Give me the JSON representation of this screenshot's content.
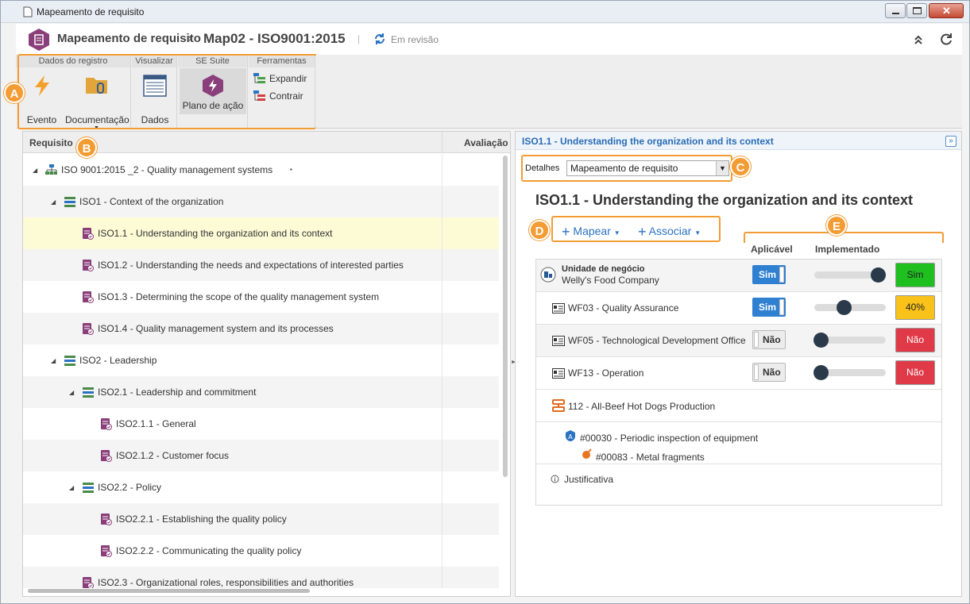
{
  "window": {
    "title": "Mapeamento de requisito"
  },
  "header": {
    "app": "Mapeamento de requisito",
    "separator": "›",
    "record": "Map02 - ISO9001:2015",
    "bar": "|",
    "status": "Em revisão"
  },
  "ribbon": {
    "groups": [
      {
        "title": "Dados do registro",
        "buttons": [
          "Evento",
          "Documentação"
        ]
      },
      {
        "title": "Visualizar",
        "buttons": [
          "Dados"
        ]
      },
      {
        "title": "SE Suite",
        "buttons": [
          "Plano de ação"
        ]
      },
      {
        "title": "Ferramentas",
        "buttons": [
          "Expandir",
          "Contrair"
        ]
      }
    ]
  },
  "markers": {
    "a": "A",
    "b": "B",
    "c": "C",
    "d": "D",
    "e": "E"
  },
  "left": {
    "col_requisito": "Requisito",
    "col_avaliacao": "Avaliação",
    "rows": [
      "ISO 9001:2015 _2 - Quality management systems",
      "ISO1 - Context of the organization",
      "ISO1.1 - Understanding the organization and its context",
      "ISO1.2 - Understanding the needs and expectations of interested parties",
      "ISO1.3 - Determining the scope of the quality management system",
      "ISO1.4 - Quality management system and its processes",
      "ISO2 - Leadership",
      "ISO2.1 - Leadership and commitment",
      "ISO2.1.1 - General",
      "ISO2.1.2 - Customer focus",
      "ISO2.2 - Policy",
      "ISO2.2.1 - Establishing the quality policy",
      "ISO2.2.2 - Communicating the quality policy",
      "ISO2.3 - Organizational roles, responsibilities and authorities"
    ]
  },
  "right": {
    "panel_title": "ISO1.1 - Understanding the organization and its context",
    "detalhes_label": "Detalhes",
    "detalhes_value": "Mapeamento de requisito",
    "title": "ISO1.1 - Understanding the organization and its context",
    "mapear": "Mapear",
    "associar": "Associar",
    "col_aplicavel": "Aplicável",
    "col_implementado": "Implementado",
    "unit_label": "Unidade de negócio",
    "unit_name": "Welly's Food Company",
    "unit_toggle": "Sim",
    "unit_badge": "Sim",
    "unit_level": 1.0,
    "wf": [
      {
        "name": "WF03 - Quality Assurance",
        "toggle": "Sim",
        "badge": "40%",
        "level": 0.4,
        "color": "#f8c21a"
      },
      {
        "name": "WF05 - Technological Development Office",
        "toggle": "Não",
        "badge": "Não",
        "level": 0.0,
        "color": "#e03a48"
      },
      {
        "name": "WF13 - Operation",
        "toggle": "Não",
        "badge": "Não",
        "level": 0.0,
        "color": "#e03a48"
      }
    ],
    "process": "112 - All-Beef Hot Dogs Production",
    "risk": "#00030 - Periodic inspection of equipment",
    "hazard": "#00083 - Metal fragments",
    "justificativa": "Justificativa"
  }
}
